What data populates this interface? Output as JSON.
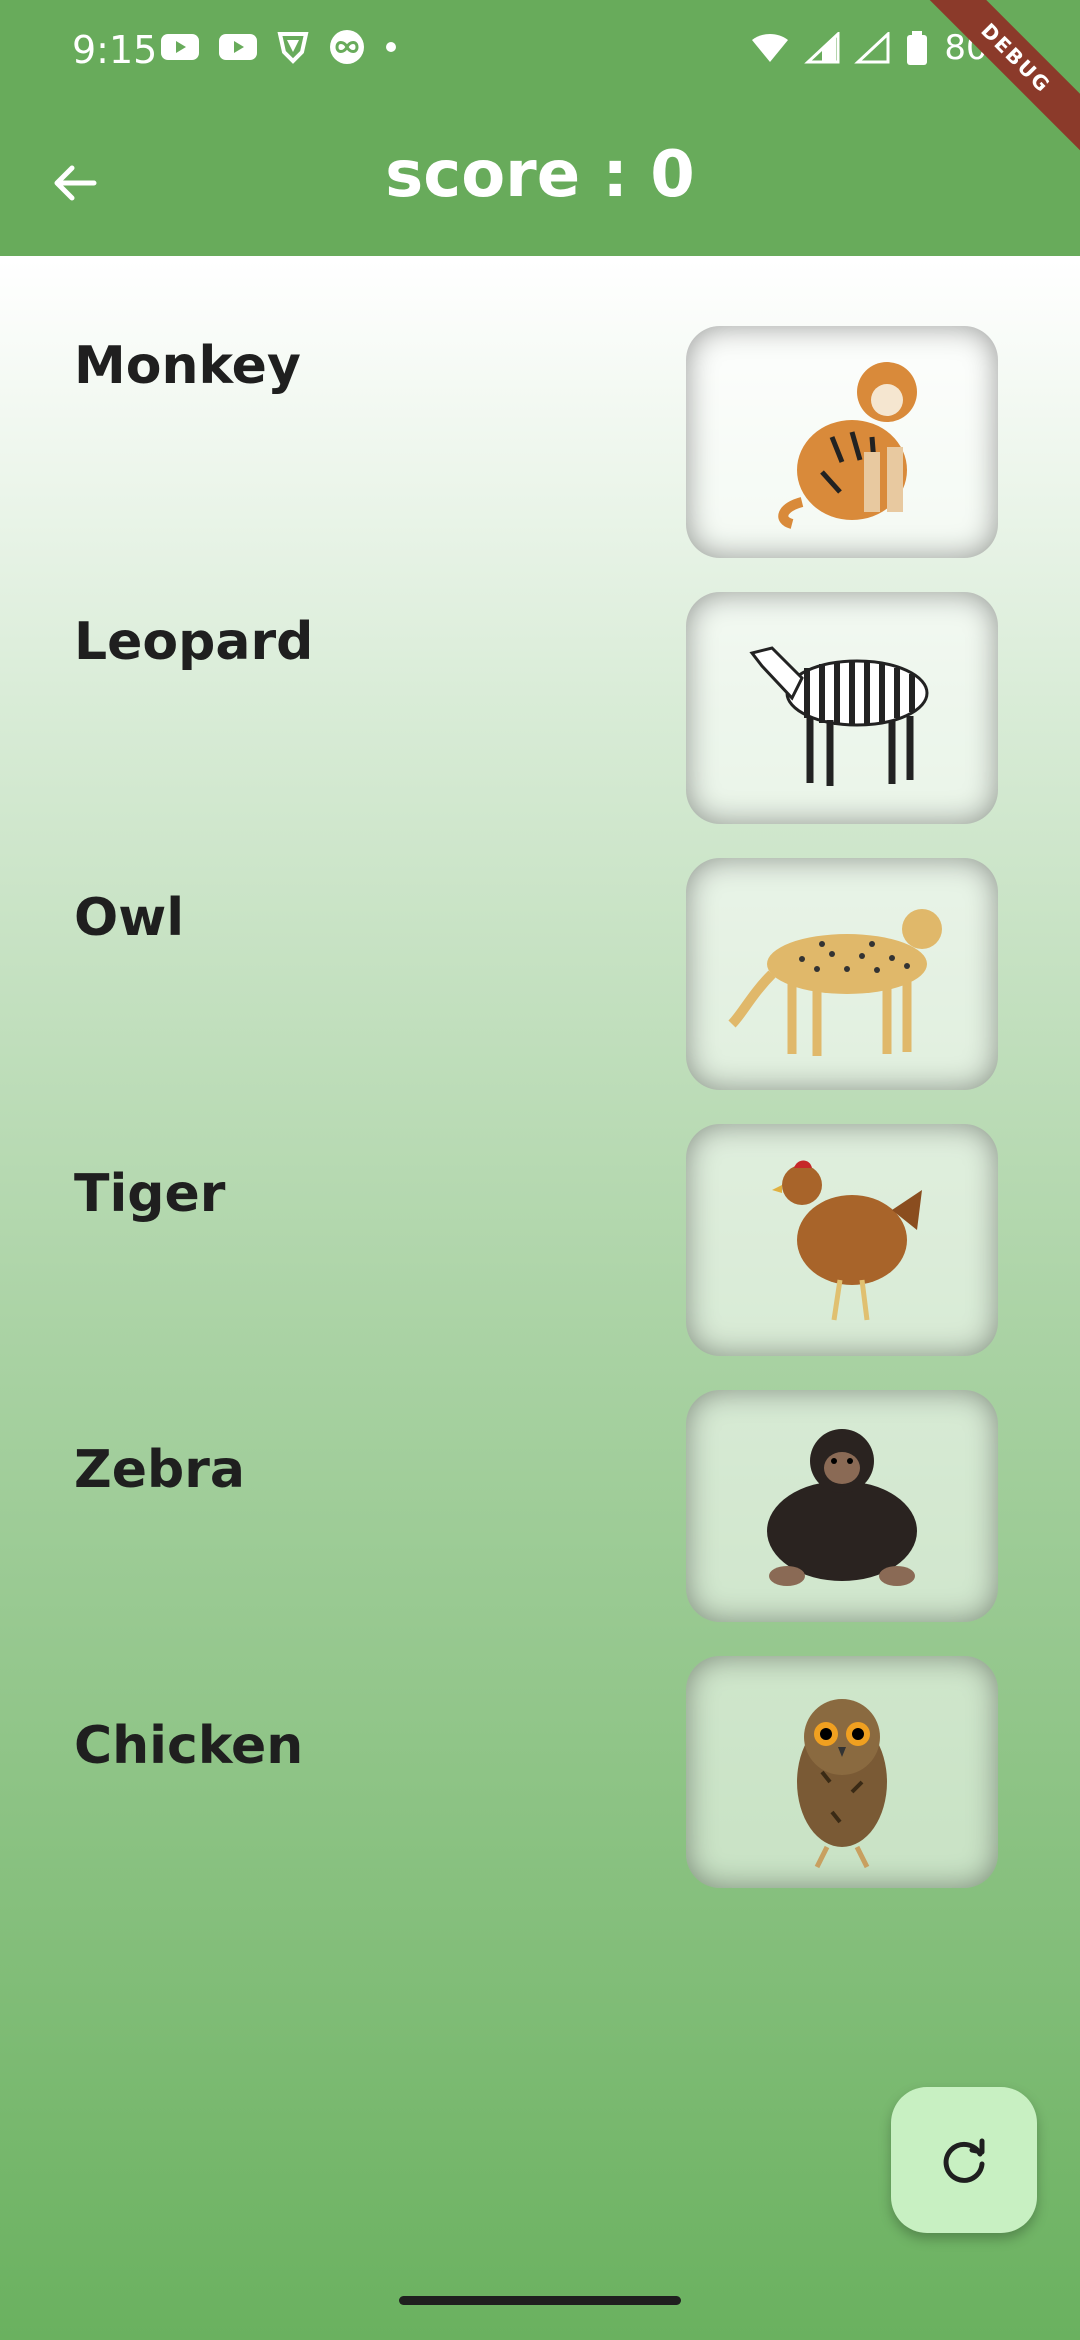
{
  "status_bar": {
    "time": "9:15",
    "battery": "80%"
  },
  "debug_banner": "DEBUG",
  "header": {
    "score_text": "score :  0"
  },
  "animals": [
    {
      "label": "Monkey",
      "image": "tiger"
    },
    {
      "label": "Leopard",
      "image": "zebra"
    },
    {
      "label": "Owl",
      "image": "cheetah"
    },
    {
      "label": "Tiger",
      "image": "chicken"
    },
    {
      "label": "Zebra",
      "image": "chimpanzee"
    },
    {
      "label": "Chicken",
      "image": "owl"
    }
  ],
  "icons": {
    "back": "arrow-left-icon",
    "refresh": "refresh-icon"
  },
  "colors": {
    "header": "#68ab5b",
    "fab": "#c8f0c2",
    "debug": "#8b3a2a"
  }
}
